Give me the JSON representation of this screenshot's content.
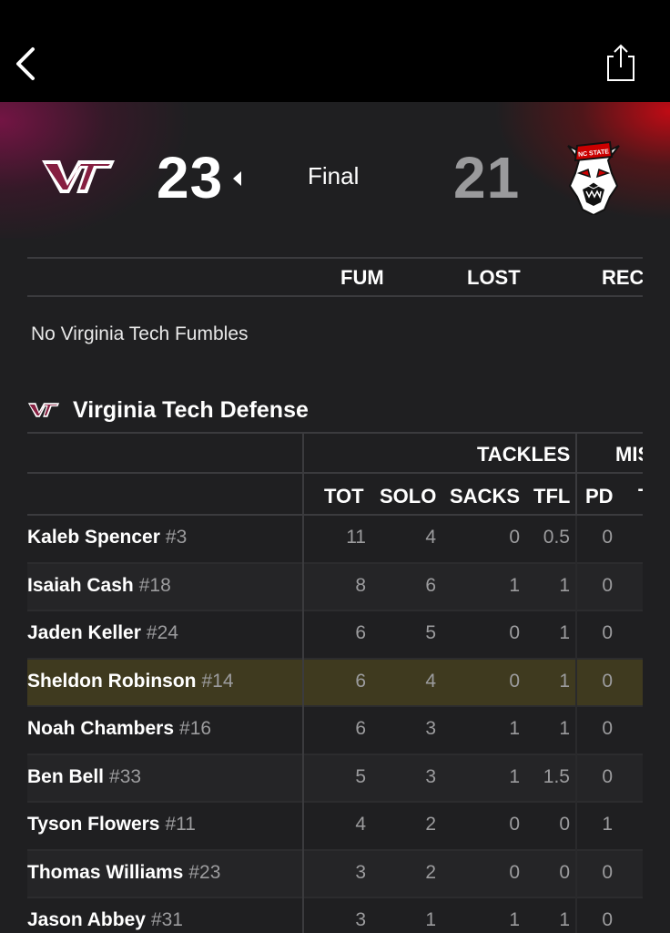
{
  "header": {
    "home_score": "23",
    "game_status": "Final",
    "away_score": "21",
    "home_logo_text": "VT",
    "away_logo_text": "NC STATE"
  },
  "fumbles": {
    "columns": [
      "FUM",
      "LOST",
      "REC"
    ],
    "empty_message": "No Virginia Tech Fumbles"
  },
  "defense": {
    "title": "Virginia Tech Defense",
    "logo_text": "VT",
    "groups": [
      "TACKLES",
      "MIS"
    ],
    "columns": [
      "TOT",
      "SOLO",
      "SACKS",
      "TFL",
      "PD",
      "T"
    ],
    "rows": [
      {
        "name": "Kaleb Spencer",
        "num": "#3",
        "tot": "11",
        "solo": "4",
        "sacks": "0",
        "tfl": "0.5",
        "pd": "0"
      },
      {
        "name": "Isaiah Cash",
        "num": "#18",
        "tot": "8",
        "solo": "6",
        "sacks": "1",
        "tfl": "1",
        "pd": "0"
      },
      {
        "name": "Jaden Keller",
        "num": "#24",
        "tot": "6",
        "solo": "5",
        "sacks": "0",
        "tfl": "1",
        "pd": "0"
      },
      {
        "name": "Sheldon Robinson",
        "num": "#14",
        "tot": "6",
        "solo": "4",
        "sacks": "0",
        "tfl": "1",
        "pd": "0"
      },
      {
        "name": "Noah Chambers",
        "num": "#16",
        "tot": "6",
        "solo": "3",
        "sacks": "1",
        "tfl": "1",
        "pd": "0"
      },
      {
        "name": "Ben Bell",
        "num": "#33",
        "tot": "5",
        "solo": "3",
        "sacks": "1",
        "tfl": "1.5",
        "pd": "0"
      },
      {
        "name": "Tyson Flowers",
        "num": "#11",
        "tot": "4",
        "solo": "2",
        "sacks": "0",
        "tfl": "0",
        "pd": "1"
      },
      {
        "name": "Thomas Williams",
        "num": "#23",
        "tot": "3",
        "solo": "2",
        "sacks": "0",
        "tfl": "0",
        "pd": "0"
      },
      {
        "name": "Jason Abbey",
        "num": "#31",
        "tot": "3",
        "solo": "1",
        "sacks": "1",
        "tfl": "1",
        "pd": "0"
      }
    ]
  },
  "colors": {
    "background": "#1f1f21",
    "highlight_row": "#3f3a1f",
    "vt_maroon": "#861f41",
    "vt_orange": "#e5751f",
    "ncstate_red": "#cc0000"
  },
  "icons": {
    "back": "chevron-left-icon",
    "share": "share-icon"
  }
}
